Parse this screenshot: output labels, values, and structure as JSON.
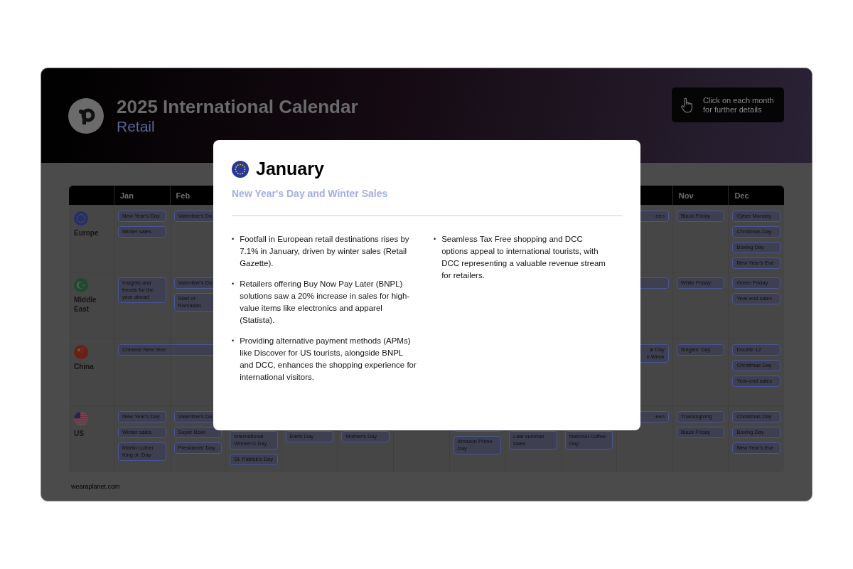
{
  "header": {
    "title": "2025 International Calendar",
    "subtitle": "Retail",
    "hint_button": {
      "line1": "Click on each month",
      "line2": "for further details"
    }
  },
  "calendar": {
    "months_left": [
      "Jan",
      "Feb"
    ],
    "months_right": [
      "Nov",
      "Dec"
    ],
    "rows": [
      {
        "region": "Europe",
        "kind": "eu",
        "cells": [
          [
            {
              "label": "New Year's Day"
            },
            {
              "label": "Winter sales"
            }
          ],
          [
            {
              "label": "Valentine's Da"
            }
          ],
          [],
          [],
          [],
          [],
          [],
          [],
          [],
          [
            {
              "label": "een",
              "kind": "cut"
            }
          ],
          [
            {
              "label": "Black Friday"
            }
          ],
          [
            {
              "label": "Cyber Monday"
            },
            {
              "label": "Christmas Day"
            },
            {
              "label": "Boxing Day"
            },
            {
              "label": "New Year's Eve"
            }
          ]
        ]
      },
      {
        "region": "Middle East",
        "kind": "crescent",
        "cells": [
          [
            {
              "label": "Insights and trends for the year ahead"
            }
          ],
          [
            {
              "label": "Valentine's Da"
            },
            {
              "label": "Start of Ramadan"
            }
          ],
          [],
          [],
          [],
          [],
          [],
          [],
          [],
          [
            {
              "kind": "blank"
            }
          ],
          [
            {
              "label": "White Friday"
            }
          ],
          [
            {
              "label": "Green Friday"
            },
            {
              "label": "Year-end sales"
            }
          ]
        ]
      },
      {
        "region": "China",
        "kind": "china",
        "cells": [
          [
            {
              "label": "Chinese New Year",
              "kind": "multi-month"
            }
          ],
          [],
          [],
          [],
          [],
          [],
          [],
          [],
          [],
          [
            {
              "label": "al Day\nn Week",
              "kind": "cut"
            }
          ],
          [
            {
              "label": "Singles' Day"
            }
          ],
          [
            {
              "label": "Double 12"
            },
            {
              "label": "Christmas Day"
            },
            {
              "label": "Year-end sales"
            }
          ]
        ]
      },
      {
        "region": "US",
        "kind": "us",
        "cells": [
          [
            {
              "label": "New Year's Day"
            },
            {
              "label": "Winter sales"
            },
            {
              "label": "Martin Luther King Jr. Day"
            }
          ],
          [
            {
              "label": "Valentine's Da"
            },
            {
              "label": "Super Bowl"
            },
            {
              "label": "Presidents' Day"
            }
          ],
          [
            {
              "label": "International Women's Day"
            },
            {
              "label": "St. Patrick's Day"
            }
          ],
          [
            {
              "label": "Earth Day"
            }
          ],
          [
            {
              "label": "Mother's Day"
            }
          ],
          [],
          [
            {
              "kind": "blank"
            },
            {
              "label": "Amazon Prime Day"
            }
          ],
          [
            {
              "label": "Late summer sales"
            }
          ],
          [
            {
              "label": "National Coffee Day"
            }
          ],
          [
            {
              "label": "een",
              "kind": "cut"
            }
          ],
          [
            {
              "label": "Thanksgiving"
            },
            {
              "label": "Black Friday"
            }
          ],
          [
            {
              "label": "Christmas Day"
            },
            {
              "label": "Boxing Day"
            },
            {
              "label": "New Year's Eve"
            }
          ]
        ]
      }
    ]
  },
  "footer": "wearaplanet.com",
  "modal": {
    "kind": "eu",
    "marker": "•",
    "title": "January",
    "subtitle": "New Year's Day and Winter Sales",
    "columns": [
      [
        "Footfall in European retail destinations rises by 7.1% in January, driven by winter sales (Retail Gazette).",
        "Retailers offering Buy Now Pay Later (BNPL) solutions saw a 20% increase in sales for high-value items like electronics and apparel (Statista).",
        "Providing alternative payment methods (APMs) like Discover for US tourists, alongside BNPL and DCC, enhances the shopping experience for international visitors."
      ],
      [
        "Seamless Tax Free shopping and DCC options appeal to international tourists, with DCC representing a valuable revenue stream for retailers."
      ]
    ]
  }
}
